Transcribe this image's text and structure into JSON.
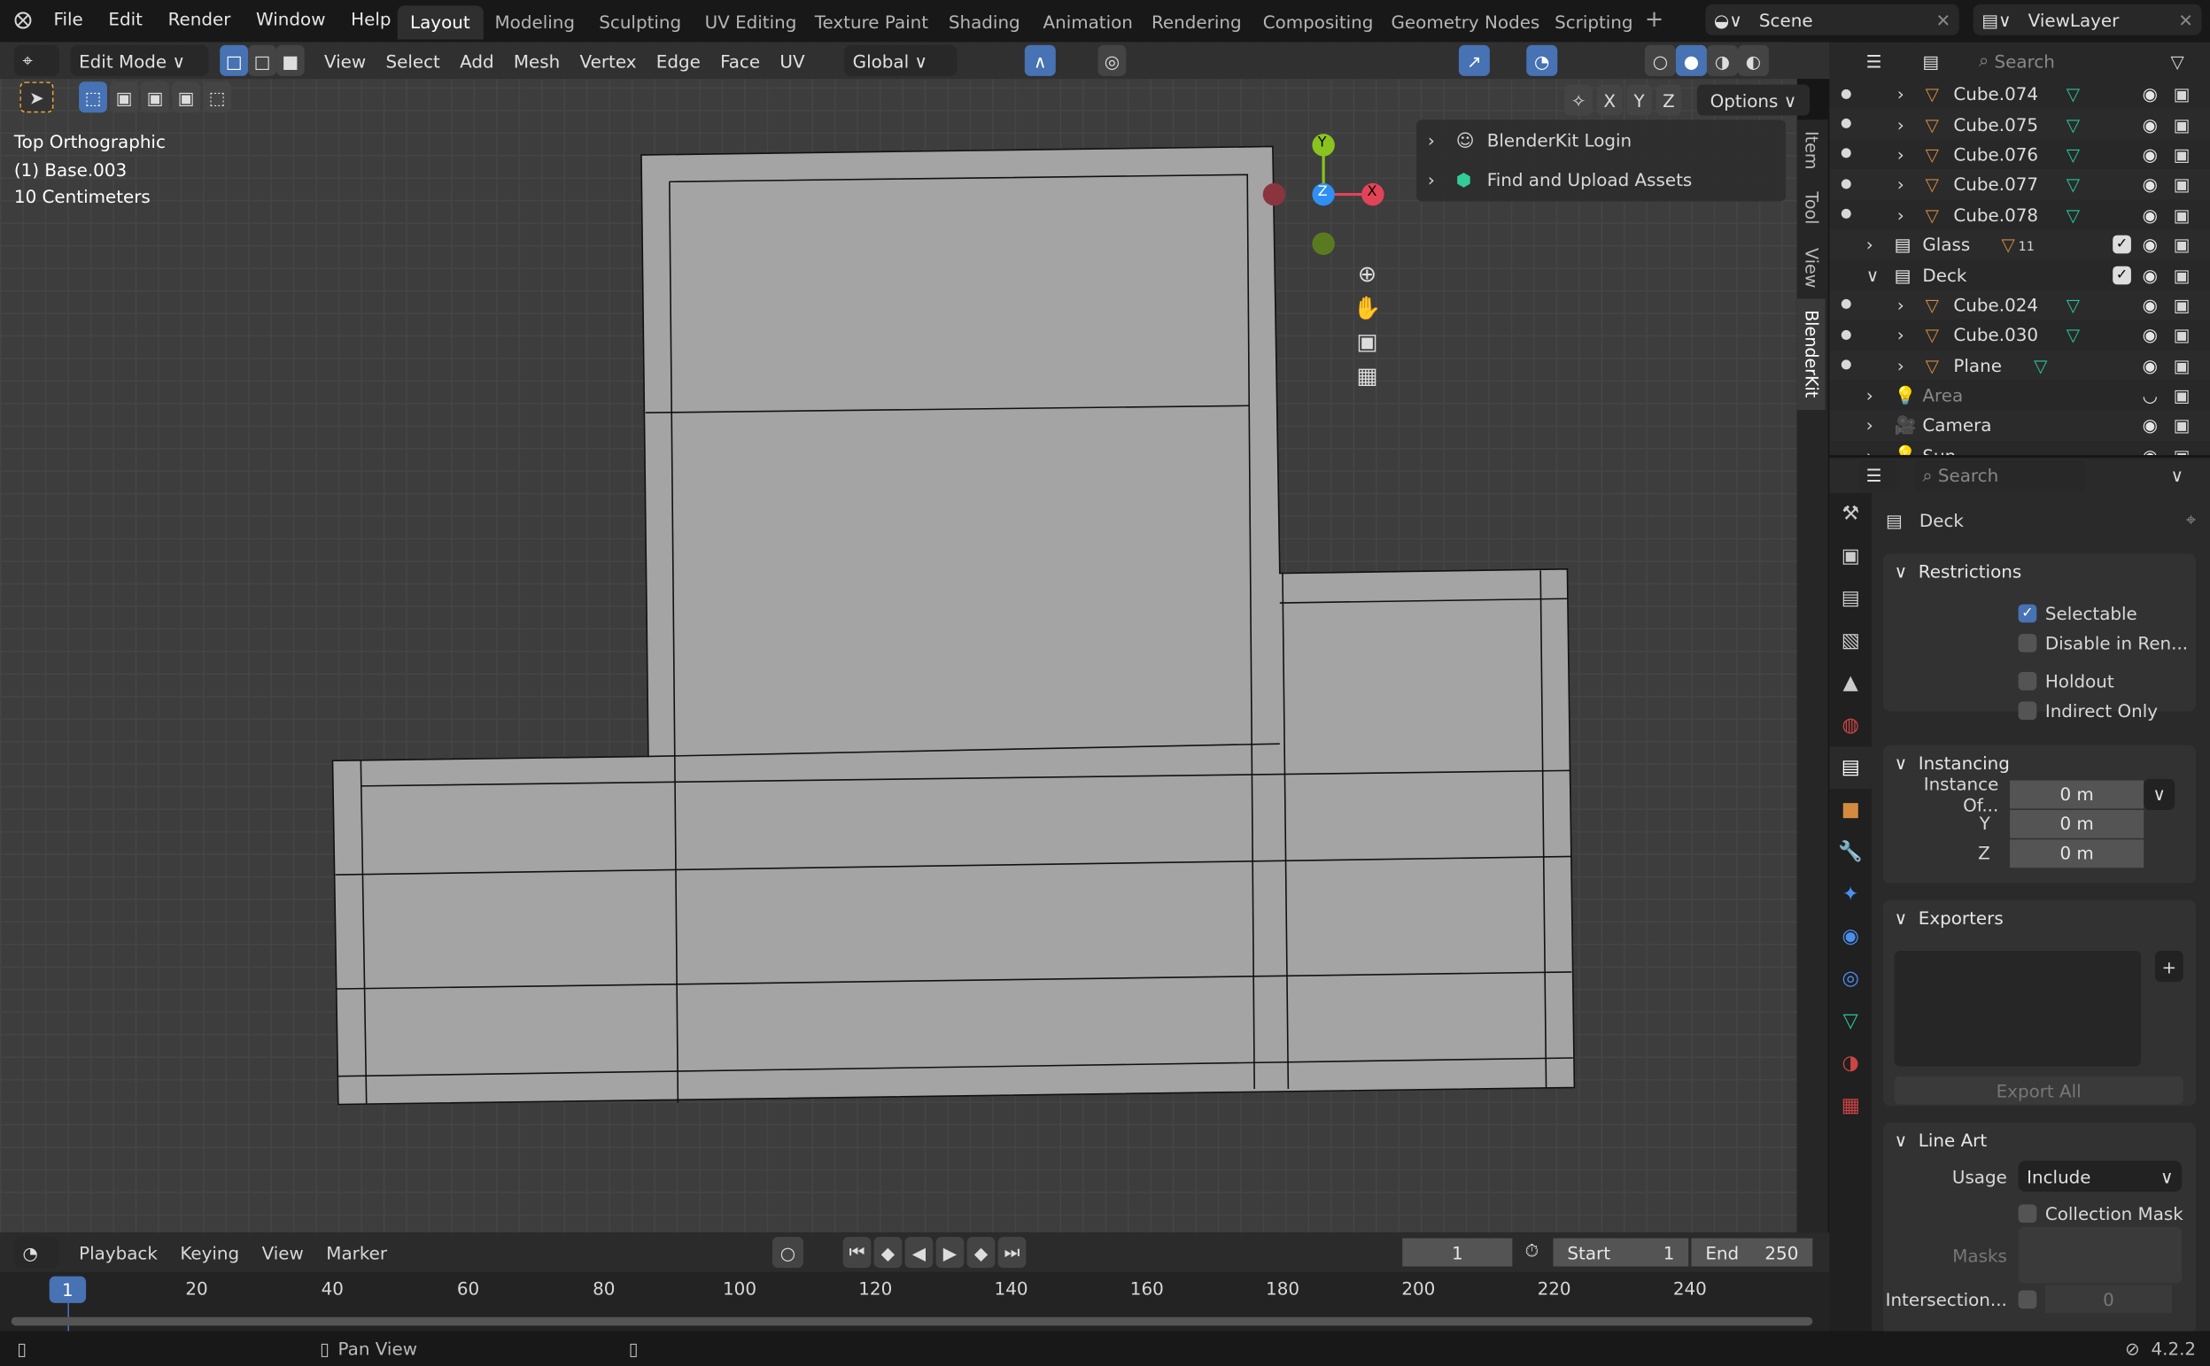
{
  "menu": {
    "items": [
      "File",
      "Edit",
      "Render",
      "Window",
      "Help"
    ]
  },
  "workspaces": [
    {
      "label": "Layout",
      "active": true
    },
    {
      "label": "Modeling"
    },
    {
      "label": "Sculpting"
    },
    {
      "label": "UV Editing"
    },
    {
      "label": "Texture Paint"
    },
    {
      "label": "Shading"
    },
    {
      "label": "Animation"
    },
    {
      "label": "Rendering"
    },
    {
      "label": "Compositing"
    },
    {
      "label": "Geometry Nodes"
    },
    {
      "label": "Scripting"
    }
  ],
  "scene": {
    "name": "Scene",
    "view_layer": "ViewLayer"
  },
  "viewport_header": {
    "mode": "Edit Mode",
    "menus": [
      "View",
      "Select",
      "Add",
      "Mesh",
      "Vertex",
      "Edge",
      "Face",
      "UV"
    ],
    "orientation": "Global",
    "options": "Options",
    "axes": [
      "X",
      "Y",
      "Z"
    ]
  },
  "viewport": {
    "view_name": "Top Orthographic",
    "object": "(1) Base.003",
    "scale": "10 Centimeters",
    "gizmo": {
      "x": "X",
      "y": "Y",
      "z": "Z"
    }
  },
  "npanel": {
    "items": [
      "BlenderKit Login",
      "Find and Upload Assets"
    ],
    "tabs": [
      "Item",
      "Tool",
      "View",
      "BlenderKit"
    ]
  },
  "outliner": {
    "search_placeholder": "Search",
    "rows": [
      {
        "name": "Cube.074",
        "type": "mesh",
        "indent": 2
      },
      {
        "name": "Cube.075",
        "type": "mesh",
        "indent": 2
      },
      {
        "name": "Cube.076",
        "type": "mesh",
        "indent": 2
      },
      {
        "name": "Cube.077",
        "type": "mesh",
        "indent": 2
      },
      {
        "name": "Cube.078",
        "type": "mesh",
        "indent": 2
      },
      {
        "name": "Glass",
        "type": "collection",
        "indent": 1,
        "count": "11"
      },
      {
        "name": "Deck",
        "type": "collection",
        "indent": 1,
        "expanded": true
      },
      {
        "name": "Cube.024",
        "type": "mesh",
        "indent": 2
      },
      {
        "name": "Cube.030",
        "type": "mesh",
        "indent": 2
      },
      {
        "name": "Plane",
        "type": "mesh",
        "indent": 2
      },
      {
        "name": "Area",
        "type": "light",
        "indent": 1,
        "hidden": true
      },
      {
        "name": "Camera",
        "type": "camera",
        "indent": 1
      },
      {
        "name": "Sun",
        "type": "light",
        "indent": 1
      }
    ]
  },
  "properties": {
    "search_placeholder": "Search",
    "collection": "Deck",
    "restrictions": {
      "title": "Restrictions",
      "items": [
        {
          "label": "Selectable",
          "checked": true
        },
        {
          "label": "Disable in Ren...",
          "checked": false
        },
        {
          "label": "Holdout",
          "checked": false
        },
        {
          "label": "Indirect Only",
          "checked": false
        }
      ]
    },
    "instancing": {
      "title": "Instancing",
      "label": "Instance Of...",
      "y": "Y",
      "z": "Z",
      "values": [
        "0 m",
        "0 m",
        "0 m"
      ]
    },
    "exporters": {
      "title": "Exporters",
      "export_all": "Export All"
    },
    "line_art": {
      "title": "Line Art",
      "usage_label": "Usage",
      "usage": "Include",
      "collection_mask": "Collection Mask",
      "masks": "Masks",
      "intersection": "Intersection...",
      "intersection_value": "0"
    }
  },
  "timeline": {
    "menus": [
      "Playback",
      "Keying",
      "View",
      "Marker"
    ],
    "current_frame": "1",
    "start_label": "Start",
    "start": "1",
    "end_label": "End",
    "end": "250",
    "ticks": [
      "20",
      "40",
      "60",
      "80",
      "100",
      "120",
      "140",
      "160",
      "180",
      "200",
      "220",
      "240"
    ]
  },
  "status": {
    "hint": "Pan View",
    "version": "4.2.2"
  },
  "colors": {
    "accent": "#4772b3",
    "mesh": "#d48a3f",
    "vertex_group": "#27c59a",
    "x_axis": "#e34358",
    "y_axis": "#8ac220",
    "z_axis": "#2f8ff2"
  }
}
